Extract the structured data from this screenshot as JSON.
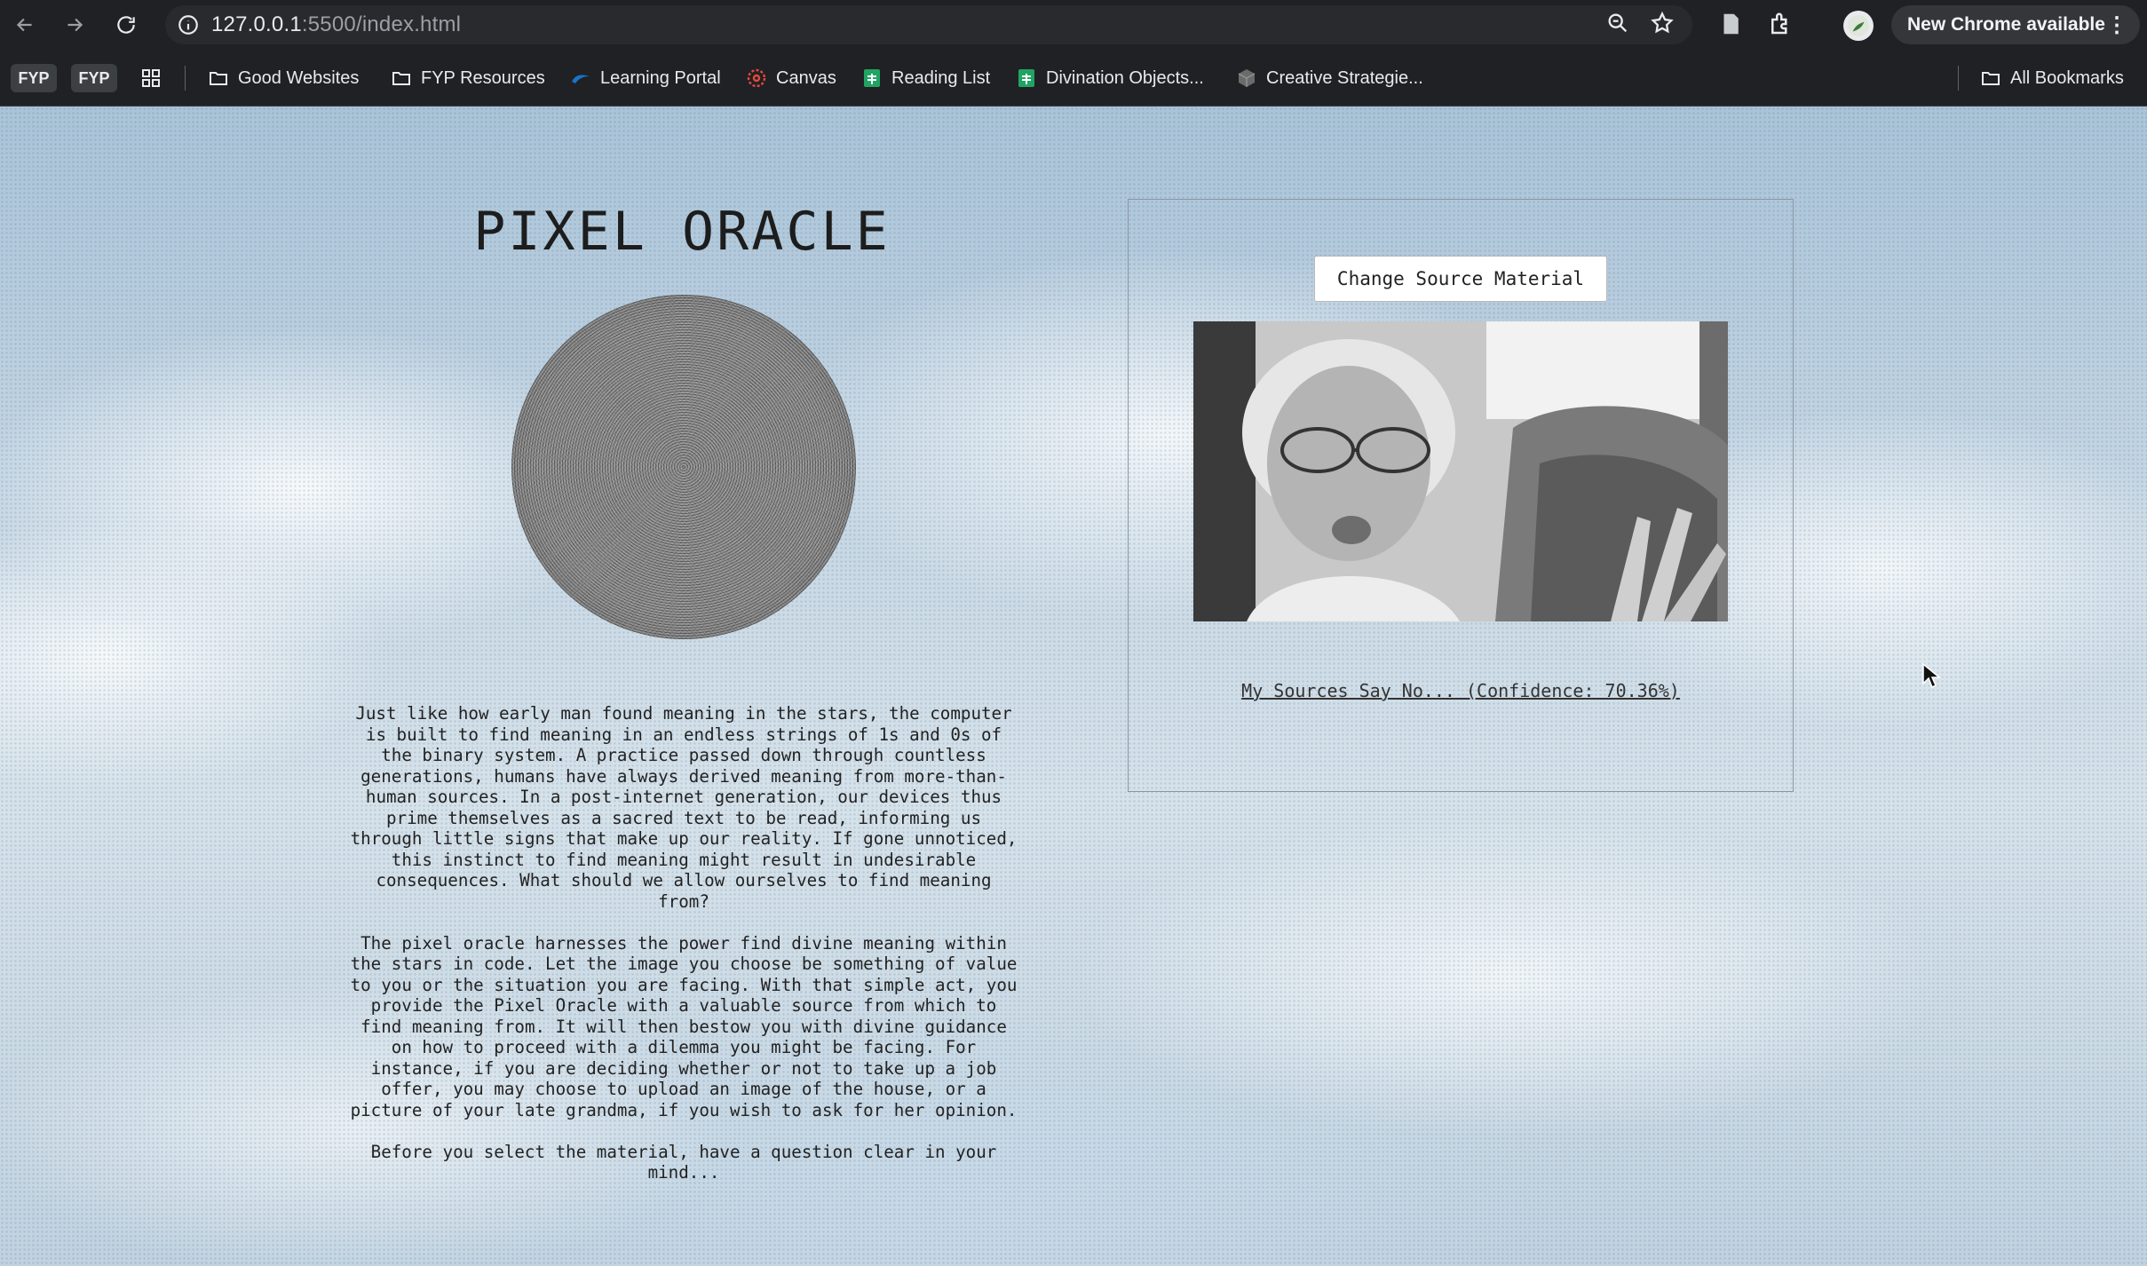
{
  "browser": {
    "url_host": "127.0.0.1",
    "url_rest": ":5500/index.html",
    "update_label": "New Chrome available"
  },
  "bookmarks": {
    "chips": [
      "FYP",
      "FYP"
    ],
    "items": [
      {
        "label": "Good Websites",
        "icon": "folder-icon"
      },
      {
        "label": "FYP Resources",
        "icon": "folder-icon"
      },
      {
        "label": "Learning Portal",
        "icon": "portal-icon"
      },
      {
        "label": "Canvas",
        "icon": "canvas-icon"
      },
      {
        "label": "Reading List",
        "icon": "sheets-icon"
      },
      {
        "label": "Divination Objects...",
        "icon": "sheets-icon"
      },
      {
        "label": "Creative Strategie...",
        "icon": "cube-icon"
      }
    ],
    "all_bookmarks": "All Bookmarks"
  },
  "main": {
    "title": "PIXEL ORACLE",
    "paragraphs": [
      "Just like how early man found meaning in the stars, the computer is built to find meaning in an endless strings of 1s and 0s of the binary system. A practice passed down through countless generations, humans have always derived meaning from more-than-human sources. In a post-internet generation, our devices thus prime themselves as a sacred text to be read, informing us through little signs that make up our reality. If gone unnoticed, this instinct to find meaning might result in undesirable consequences. What should we allow ourselves to find meaning from?",
      "The pixel oracle harnesses the power find divine meaning within the stars in code. Let the image you choose be something of value to you or the situation you are facing. With that simple act, you provide the Pixel Oracle with a valuable source from which to find meaning from. It will then bestow you with divine guidance on how to proceed with a dilemma you might be facing. For instance, if you are deciding whether or not to take up a job offer, you may choose to upload an image of the house, or a picture of your late grandma, if you wish to ask for her opinion.",
      "Before you select the material, have a question clear in your mind..."
    ]
  },
  "oracle": {
    "button_label": "Change Source Material",
    "result": "My Sources Say No... (Confidence: 70.36%)"
  },
  "colors": {
    "chrome_bg": "#202124",
    "sky_top": "#a9c3d8",
    "text": "#222222"
  }
}
